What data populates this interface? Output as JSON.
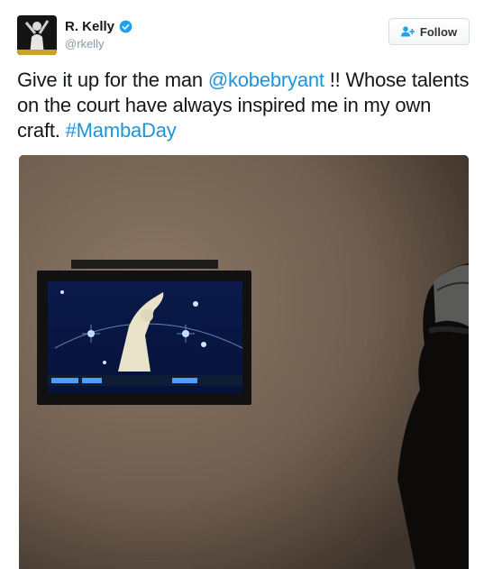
{
  "user": {
    "display_name": "R. Kelly",
    "handle": "@rkelly",
    "verified": true,
    "avatar_icon": "user-avatar"
  },
  "follow_button": {
    "label": "Follow",
    "icon": "add-user-icon"
  },
  "tweet": {
    "text_before_mention": "Give it up for the man ",
    "mention": "@kobebryant",
    "text_after_mention": " !! Whose talents on the court have always inspired me in my own craft. ",
    "hashtag": "#MambaDay"
  },
  "media": {
    "description_icon": "photo-tv-on-wall"
  },
  "colors": {
    "link": "#1b95e0",
    "verified": "#1da1f2",
    "text": "#14171a",
    "handle": "#8899a6"
  }
}
